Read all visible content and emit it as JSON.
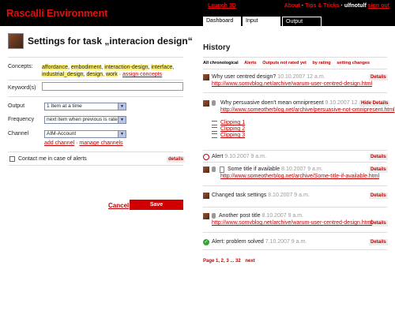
{
  "header": {
    "brand": "Rascalli Environment",
    "launch": "Launch 3D",
    "about": "About",
    "tips": "Tips & Tricks",
    "user": "ulfnotulf",
    "signout": "sign out",
    "tabs": [
      {
        "label": "Dashboard"
      },
      {
        "label": "Input"
      },
      {
        "label": "Output"
      }
    ]
  },
  "settings": {
    "title": "Settings for task „interacion design“",
    "concepts_label": "Concepts:",
    "concepts": [
      "affordance",
      "embodiment",
      "interaction-design",
      "interface",
      "industrial_design",
      "design",
      "work"
    ],
    "assign_concepts": "assign concepts",
    "keywords_label": "Keyword(s)",
    "keywords_value": "",
    "output_label": "Output",
    "output_value": "1 Item at a time",
    "frequency_label": "Frequency",
    "frequency_value": "next item when previous is rated",
    "channel_label": "Channel",
    "channel_value": "AIM-Account",
    "add_channel": "add channel",
    "manage_channels": "manage channels",
    "contact_label": "Contact me in case of alerts",
    "details": "details",
    "cancel": "Cancel",
    "save": "Save"
  },
  "history": {
    "title": "History",
    "filters": {
      "all": "All chronological",
      "alerts": "Alerts",
      "not_rated": "Outputs not rated yet",
      "by_rating": "by rating",
      "setting_changes": "setting changes"
    },
    "details": "Details",
    "hide_details": "Hide Details",
    "items": [
      {
        "title": "Why user centred design?",
        "date": "10.10.2007 12 a.m.",
        "link": "http://www.somvblog.net/archive/warum-user-centred-design.html"
      },
      {
        "title": "Why persuasive doen't mean omnipresent",
        "date": "9.10.2007 12 a.m.",
        "link": "http://www.someotherblog.net/archive/persuasive-not-omnipresent.html"
      },
      {
        "title": "Alert",
        "date": "9.10.2007 9 a.m."
      },
      {
        "title": "Some title if available",
        "date": "8.10.2007 9 a.m.",
        "link": "http://www.someotherblog.net/archive/Some-title-if-available.html"
      },
      {
        "title": "Changed task settings",
        "date": "8.10.2007 9 a.m."
      },
      {
        "title": "Another post title",
        "date": "8.10.2007 9 a.m.",
        "link": "http://www.somvblog.net/archive/warum-user-centred-design.html"
      },
      {
        "title": "Alert: problem solved",
        "date": "7.10.2007 9 a.m."
      }
    ],
    "clippings": [
      "Clipping 1",
      "Clipping 2",
      "Clipping 3"
    ],
    "pager": "Page 1, 2, 3 ... 32",
    "next": "next"
  }
}
